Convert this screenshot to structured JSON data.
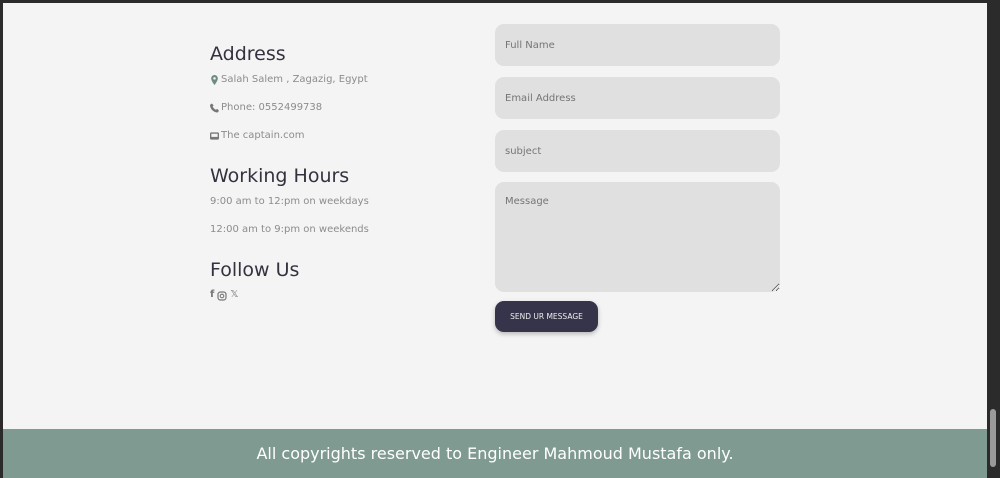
{
  "address": {
    "title": "Address",
    "location": "Salah Salem , Zagazig, Egypt",
    "phone": "Phone: 0552499738",
    "website": "The captain.com"
  },
  "hours": {
    "title": "Working Hours",
    "weekdays": "9:00 am to 12:pm on weekdays",
    "weekends": "12:00 am to 9:pm on weekends"
  },
  "follow": {
    "title": "Follow Us",
    "icons": [
      "facebook-icon",
      "instagram-icon",
      "x-icon"
    ]
  },
  "form": {
    "name_placeholder": "Full Name",
    "email_placeholder": "Email Address",
    "subject_placeholder": "subject",
    "message_placeholder": "Message",
    "submit_label": "SEND UR MESSAGE"
  },
  "footer": {
    "text": "All copyrights reserved to Engineer Mahmoud Mustafa only."
  },
  "colors": {
    "accent": "#7f9a90",
    "button": "#35344a"
  }
}
